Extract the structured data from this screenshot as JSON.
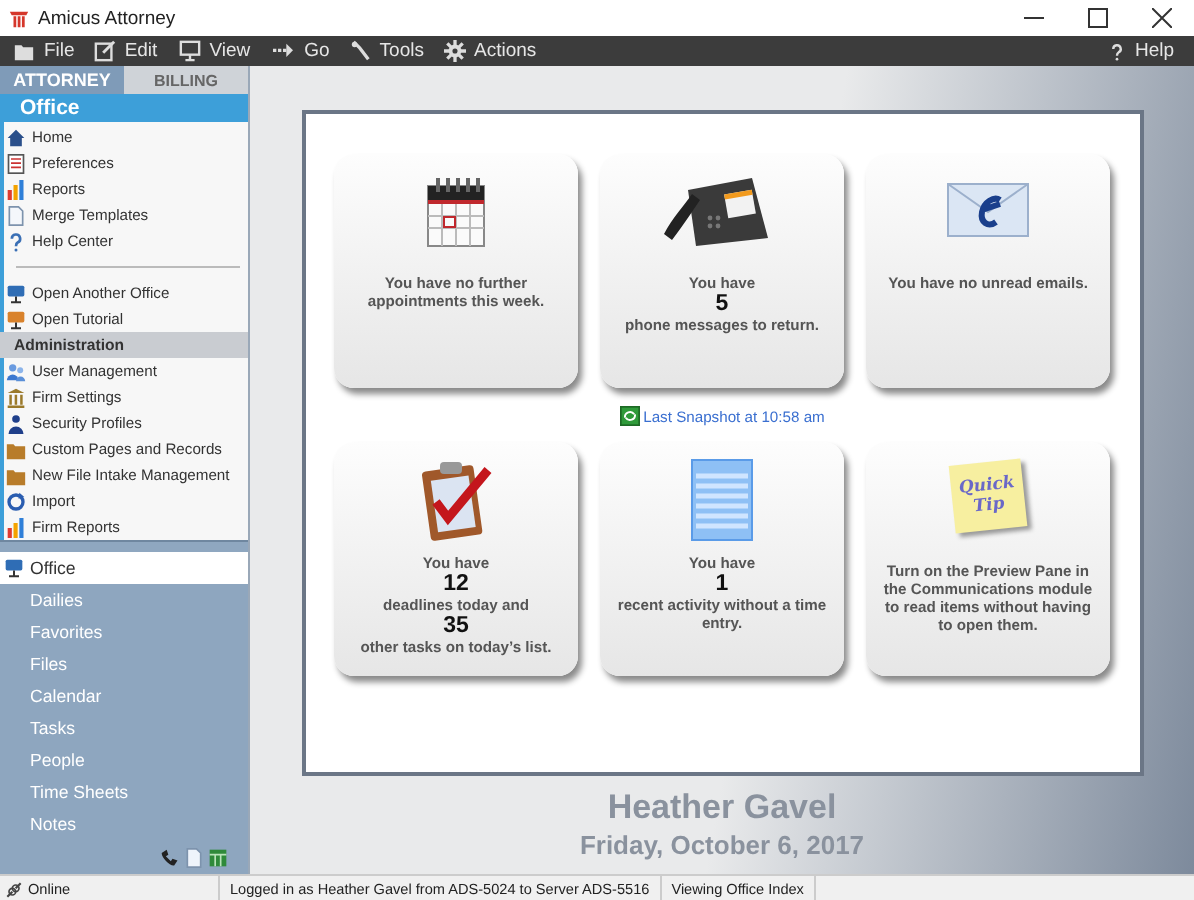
{
  "window": {
    "title": "Amicus Attorney"
  },
  "menu": [
    {
      "label": "File"
    },
    {
      "label": "Edit"
    },
    {
      "label": "View"
    },
    {
      "label": "Go"
    },
    {
      "label": "Tools"
    },
    {
      "label": "Actions"
    }
  ],
  "help": "Help",
  "sidebar": {
    "tabs": [
      {
        "label": "ATTORNEY",
        "selected": true
      },
      {
        "label": "BILLING",
        "selected": false
      }
    ],
    "header": "Office",
    "sections": [
      {
        "items": [
          "Home",
          "Preferences",
          "Reports",
          "Merge Templates",
          "Help Center"
        ]
      },
      {
        "items": [
          "Open Another Office",
          "Open Tutorial"
        ]
      },
      {
        "header": "Administration",
        "items": [
          "User Management",
          "Firm Settings",
          "Security Profiles",
          "Custom Pages and Records",
          "New File Intake Management",
          "Import",
          "Firm Reports"
        ]
      }
    ],
    "nav": [
      {
        "label": "Office",
        "selected": true
      },
      {
        "label": "Dailies",
        "selected": false
      },
      {
        "label": "Favorites",
        "selected": false
      },
      {
        "label": "Files",
        "selected": false
      },
      {
        "label": "Calendar",
        "selected": false
      },
      {
        "label": "Tasks",
        "selected": false
      },
      {
        "label": "People",
        "selected": false
      },
      {
        "label": "Time Sheets",
        "selected": false
      },
      {
        "label": "Notes",
        "selected": false
      }
    ]
  },
  "dashboard": {
    "cards": [
      {
        "lines": [
          {
            "kind": "text",
            "text": "You have no further appointments this week."
          }
        ]
      },
      {
        "lines": [
          {
            "kind": "text",
            "text": "You have"
          },
          {
            "kind": "number",
            "text": "5"
          },
          {
            "kind": "text",
            "text": "phone messages to return."
          }
        ]
      },
      {
        "lines": [
          {
            "kind": "text",
            "text": "You have no unread emails."
          }
        ]
      },
      {
        "lines": [
          {
            "kind": "text",
            "text": "You have"
          },
          {
            "kind": "number",
            "text": "12"
          },
          {
            "kind": "text",
            "text": "deadlines today and"
          },
          {
            "kind": "number",
            "text": "35"
          },
          {
            "kind": "text",
            "text": "other tasks on today’s list."
          }
        ]
      },
      {
        "lines": [
          {
            "kind": "text",
            "text": "You have"
          },
          {
            "kind": "number",
            "text": "1"
          },
          {
            "kind": "text",
            "text": "recent activity without a time entry."
          }
        ]
      },
      {
        "note": "Quick Tip",
        "lines": [
          {
            "kind": "text",
            "text": "Turn on the Preview Pane in the Communications module to read items without having to open them."
          }
        ]
      }
    ],
    "snapshot": "Last Snapshot at 10:58 am",
    "user": "Heather Gavel",
    "date": "Friday, October 6, 2017"
  },
  "status_bar": {
    "connection": "Online",
    "cells": [
      "Logged in as Heather Gavel from ADS-5024 to Server ADS-5516",
      "Viewing Office Index"
    ]
  }
}
